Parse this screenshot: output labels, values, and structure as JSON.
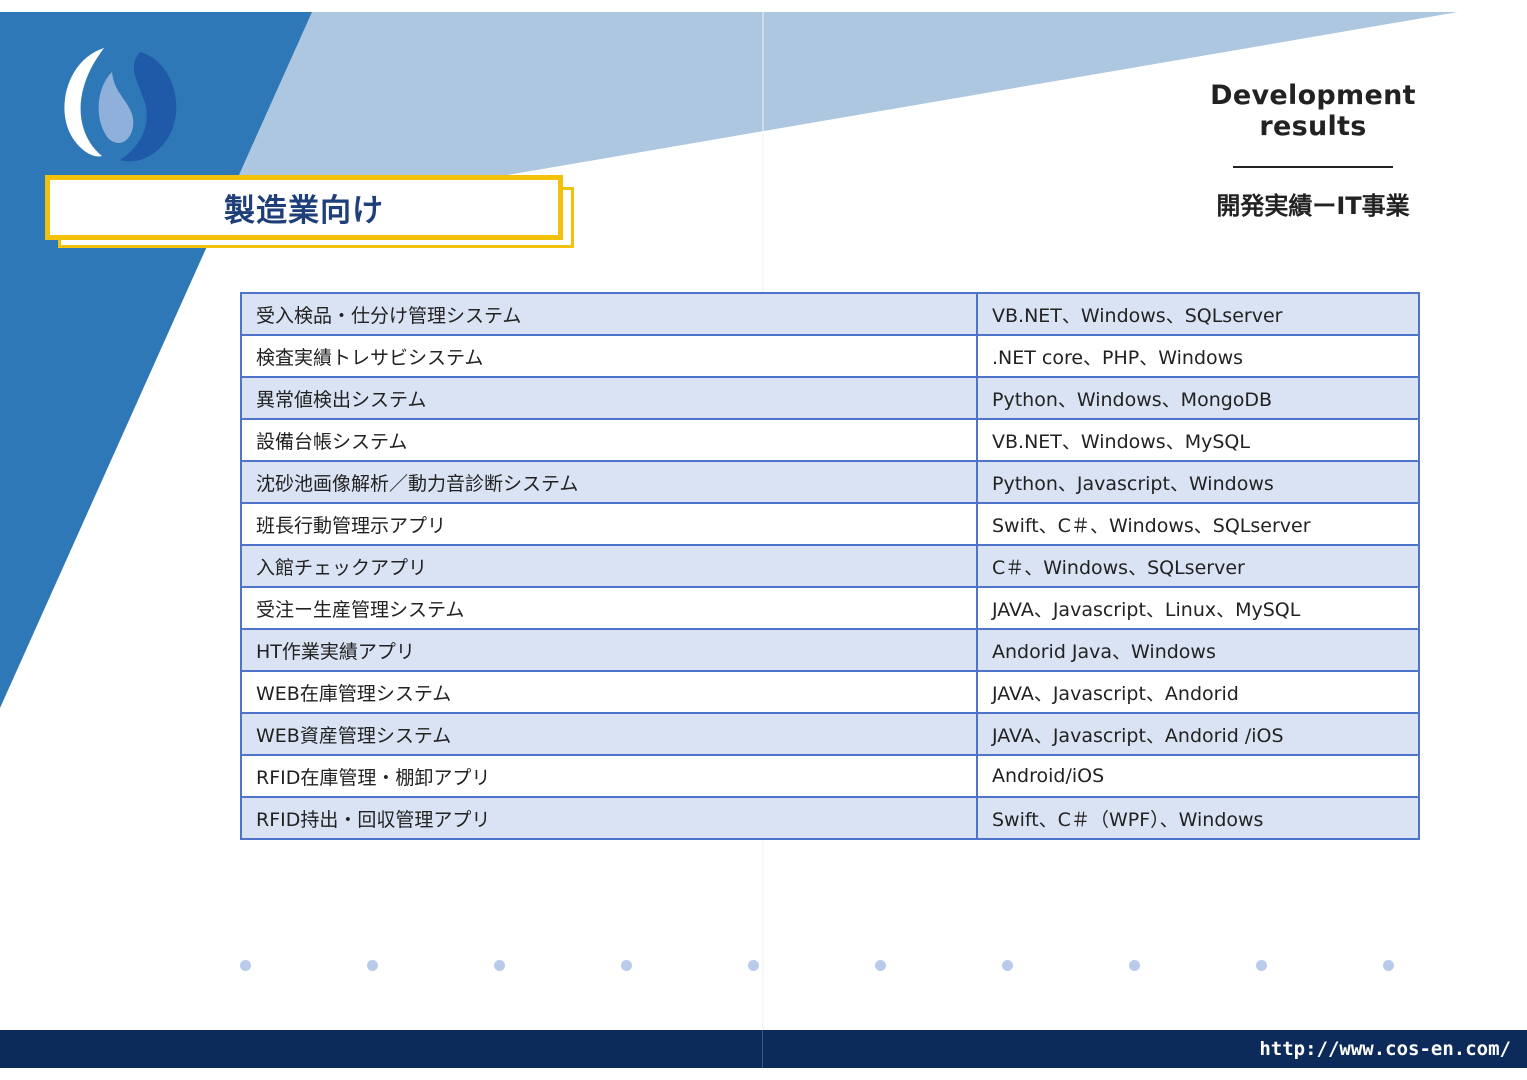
{
  "header": {
    "title_en": "Development results",
    "title_jp": "開発実績ーIT事業"
  },
  "section_title": "製造業向け",
  "table": {
    "rows": [
      {
        "name": "受入検品・仕分け管理システム",
        "tech": "VB.NET、Windows、SQLserver"
      },
      {
        "name": "検査実績トレサビシステム",
        "tech": ".NET core、PHP、Windows"
      },
      {
        "name": "異常値検出システム",
        "tech": "Python、Windows、MongoDB"
      },
      {
        "name": "設備台帳システム",
        "tech": "VB.NET、Windows、MySQL"
      },
      {
        "name": "沈砂池画像解析／動力音診断システム",
        "tech": "Python、Javascript、Windows"
      },
      {
        "name": "班長行動管理示アプリ",
        "tech": "Swift、C＃、Windows、SQLserver"
      },
      {
        "name": "入館チェックアプリ",
        "tech": "C＃、Windows、SQLserver"
      },
      {
        "name": "受注ー生産管理システム",
        "tech": "JAVA、Javascript、Linux、MySQL"
      },
      {
        "name": "HT作業実績アプリ",
        "tech": "Andorid Java、Windows"
      },
      {
        "name": "WEB在庫管理システム",
        "tech": "JAVA、Javascript、Andorid"
      },
      {
        "name": "WEB資産管理システム",
        "tech": "JAVA、Javascript、Andorid /iOS"
      },
      {
        "name": "RFID在庫管理・棚卸アプリ",
        "tech": "Android/iOS"
      },
      {
        "name": "RFID持出・回収管理アプリ",
        "tech": "Swift、C＃（WPF）、Windows"
      }
    ]
  },
  "footer": {
    "url": "http://www.cos-en.com/"
  },
  "colors": {
    "accent_yellow": "#f2c10a",
    "navy": "#0d2b5a",
    "table_border": "#4e73c9",
    "row_tint": "#dae3f4",
    "dot": "#b9cbea"
  },
  "icons": {
    "logo": "company-logo"
  }
}
